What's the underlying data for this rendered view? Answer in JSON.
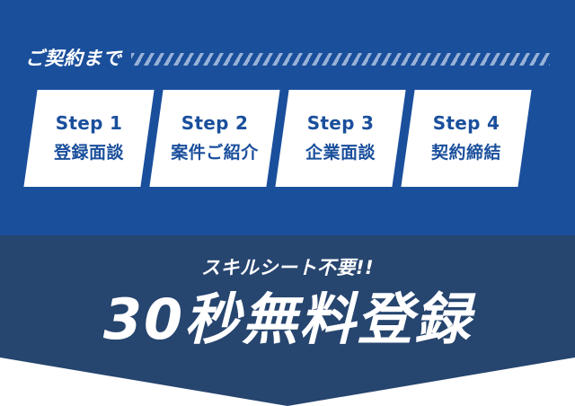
{
  "colors": {
    "top_bg": "#1a4f9c",
    "bottom_bg": "#26456f",
    "card_bg": "#ffffff",
    "card_text": "#1a4f9c",
    "dash": "#9fb6da"
  },
  "heading": "ご契約まで",
  "steps": [
    {
      "number": "Step 1",
      "label": "登録面談"
    },
    {
      "number": "Step 2",
      "label": "案件ご紹介"
    },
    {
      "number": "Step 3",
      "label": "企業面談"
    },
    {
      "number": "Step 4",
      "label": "契約締結"
    }
  ],
  "cta": {
    "sub": "スキルシート不要!!",
    "main": "30秒無料登録"
  }
}
